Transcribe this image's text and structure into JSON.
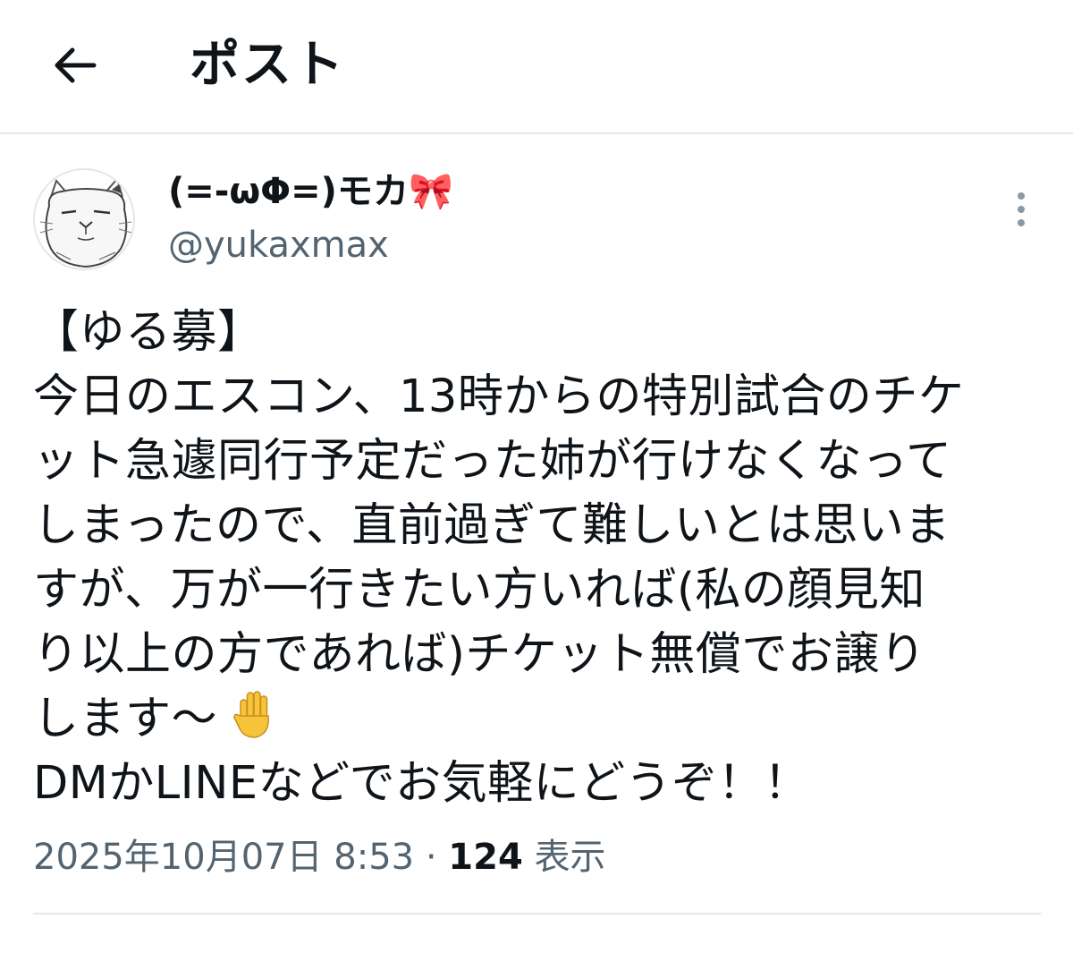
{
  "header": {
    "back_icon": "arrow-left-icon",
    "title": "ポスト"
  },
  "author": {
    "display_name": "(=-ωΦ=)モカ🎀",
    "handle": "@yukaxmax",
    "avatar_icon": "cat-sketch-avatar"
  },
  "more_icon": "more-vertical-icon",
  "tweet": {
    "lines": [
      "【ゆる募】",
      "今日のエスコン、13時からの特別試合のチケ",
      "ット急遽同行予定だった姉が行けなくなって",
      "しまったので、直前過ぎて難しいとは思いま",
      "すが、万が一行きたい方いれば(私の顔見知",
      "り以上の方であれば)チケット無償でお譲り",
      "します〜",
      "DMかLINEなどでお気軽にどうぞ！！"
    ],
    "hand_icon": "raised-hand-icon"
  },
  "meta": {
    "timestamp": "2025年10月07日 8:53",
    "separator": "·",
    "views_count": "124",
    "views_label": "表示"
  },
  "colors": {
    "text": "#0f1419",
    "secondary": "#536471",
    "divider": "#e3e7ea",
    "hand": "#f7c33b"
  }
}
